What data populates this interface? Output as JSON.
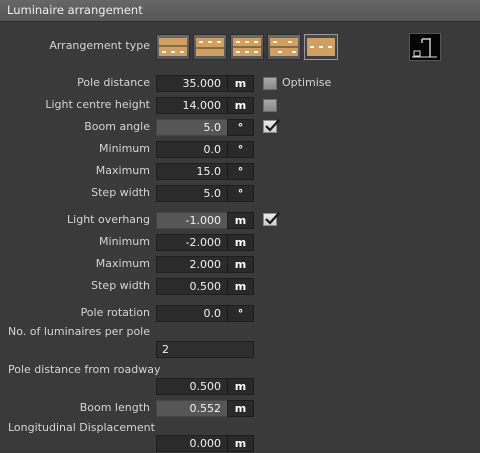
{
  "panel": {
    "title": "Luminaire arrangement",
    "arrangement_type_label": "Arrangement type",
    "arrangement_options": [
      {
        "icon": "single-side-bottom-arrangement-icon",
        "selected": false
      },
      {
        "icon": "single-side-top-arrangement-icon",
        "selected": false
      },
      {
        "icon": "opposite-arrangement-icon",
        "selected": false
      },
      {
        "icon": "staggered-arrangement-icon",
        "selected": false
      },
      {
        "icon": "central-arrangement-icon",
        "selected": true
      },
      {
        "icon": "pole-bracket-icon",
        "selected": false
      }
    ]
  },
  "rows": {
    "pole_distance": {
      "label": "Pole distance",
      "value": "35.000",
      "unit": "m"
    },
    "optimise": {
      "label": "Optimise",
      "checked": false
    },
    "light_centre_height": {
      "label": "Light centre height",
      "value": "14.000",
      "unit": "m",
      "checked": false
    },
    "boom_angle": {
      "label": "Boom angle",
      "value": "5.0",
      "unit": "°",
      "checked": true
    },
    "boom_minimum": {
      "label": "Minimum",
      "value": "0.0",
      "unit": "°"
    },
    "boom_maximum": {
      "label": "Maximum",
      "value": "15.0",
      "unit": "°"
    },
    "boom_step": {
      "label": "Step width",
      "value": "5.0",
      "unit": "°"
    },
    "light_overhang": {
      "label": "Light overhang",
      "value": "-1.000",
      "unit": "m",
      "checked": true
    },
    "overhang_minimum": {
      "label": "Minimum",
      "value": "-2.000",
      "unit": "m"
    },
    "overhang_maximum": {
      "label": "Maximum",
      "value": "2.000",
      "unit": "m"
    },
    "overhang_step": {
      "label": "Step width",
      "value": "0.500",
      "unit": "m"
    },
    "pole_rotation": {
      "label": "Pole rotation",
      "value": "0.0",
      "unit": "°"
    },
    "luminaires_per_pole": {
      "label": "No. of luminaires per pole",
      "value": "2"
    },
    "pole_distance_from_roadway": {
      "label": "Pole distance from roadway",
      "value": "0.500",
      "unit": "m"
    },
    "boom_length": {
      "label": "Boom length",
      "value": "0.552",
      "unit": "m"
    },
    "longitudinal_displacement": {
      "label": "Longitudinal Displacement",
      "value": "0.000",
      "unit": "m"
    }
  },
  "colors": {
    "panel_bg": "#3a3a3a",
    "title_bg": "#5e5e5e",
    "field_bg": "#2b2b2b",
    "field_disabled_bg": "#565656",
    "arrangement_road": "#cfa064"
  }
}
